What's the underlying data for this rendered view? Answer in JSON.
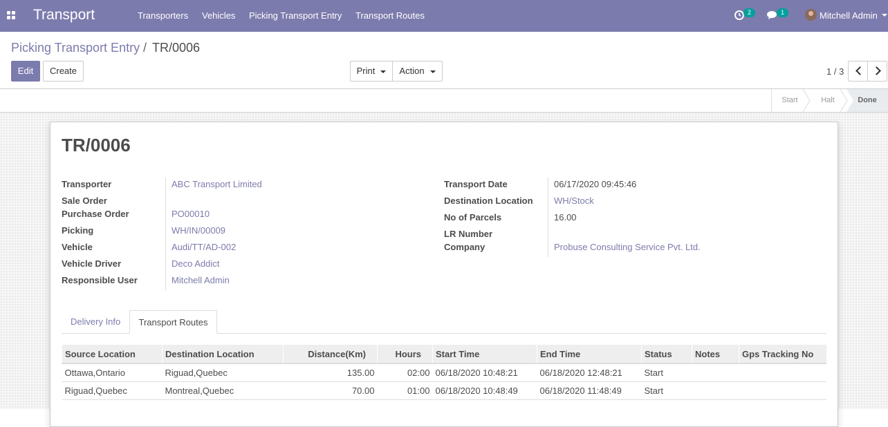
{
  "topbar": {
    "app_title": "Transport",
    "menu": [
      "Transporters",
      "Vehicles",
      "Picking Transport Entry",
      "Transport Routes"
    ],
    "activity_count": "2",
    "messages_count": "1",
    "user_name": "Mitchell Admin",
    "colors": {
      "bar": "#7c7bad",
      "badge": "#00a09d"
    }
  },
  "breadcrumb": {
    "parent": "Picking Transport Entry",
    "separator": "/",
    "current": "TR/0006"
  },
  "buttons": {
    "edit": "Edit",
    "create": "Create",
    "print": "Print",
    "action": "Action"
  },
  "pager": {
    "value": "1 / 3"
  },
  "statusbar": {
    "stages": [
      "Start",
      "Halt",
      "Done"
    ],
    "current": "Done"
  },
  "record": {
    "name": "TR/0006",
    "left_fields": [
      {
        "label": "Transporter",
        "value": "ABC Transport Limited",
        "link": true
      },
      {
        "label": "Sale Order",
        "value": "",
        "link": true
      },
      {
        "label": "Purchase Order",
        "value": "PO00010",
        "link": true
      },
      {
        "label": "Picking",
        "value": "WH/IN/00009",
        "link": true
      },
      {
        "label": "Vehicle",
        "value": "Audi/TT/AD-002",
        "link": true
      },
      {
        "label": "Vehicle Driver",
        "value": "Deco Addict",
        "link": true
      },
      {
        "label": "Responsible User",
        "value": "Mitchell Admin",
        "link": true
      }
    ],
    "right_fields": [
      {
        "label": "Transport Date",
        "value": "06/17/2020 09:45:46",
        "link": false
      },
      {
        "label": "Destination Location",
        "value": "WH/Stock",
        "link": true
      },
      {
        "label": "No of Parcels",
        "value": "16.00",
        "link": false
      },
      {
        "label": "LR Number",
        "value": "",
        "link": false
      },
      {
        "label": "Company",
        "value": "Probuse Consulting Service Pvt. Ltd.",
        "link": true
      }
    ]
  },
  "tabs": {
    "items": [
      "Delivery Info",
      "Transport Routes"
    ],
    "active": "Transport Routes"
  },
  "routes_table": {
    "columns": [
      "Source Location",
      "Destination Location",
      "Distance(Km)",
      "Hours",
      "Start Time",
      "End Time",
      "Status",
      "Notes",
      "Gps Tracking No"
    ],
    "rows": [
      [
        "Ottawa,Ontario",
        "Riguad,Quebec",
        "135.00",
        "02:00",
        "06/18/2020 10:48:21",
        "06/18/2020 12:48:21",
        "Start",
        "",
        ""
      ],
      [
        "Riguad,Quebec",
        "Montreal,Quebec",
        "70.00",
        "01:00",
        "06/18/2020 10:48:49",
        "06/18/2020 11:48:49",
        "Start",
        "",
        ""
      ]
    ]
  }
}
